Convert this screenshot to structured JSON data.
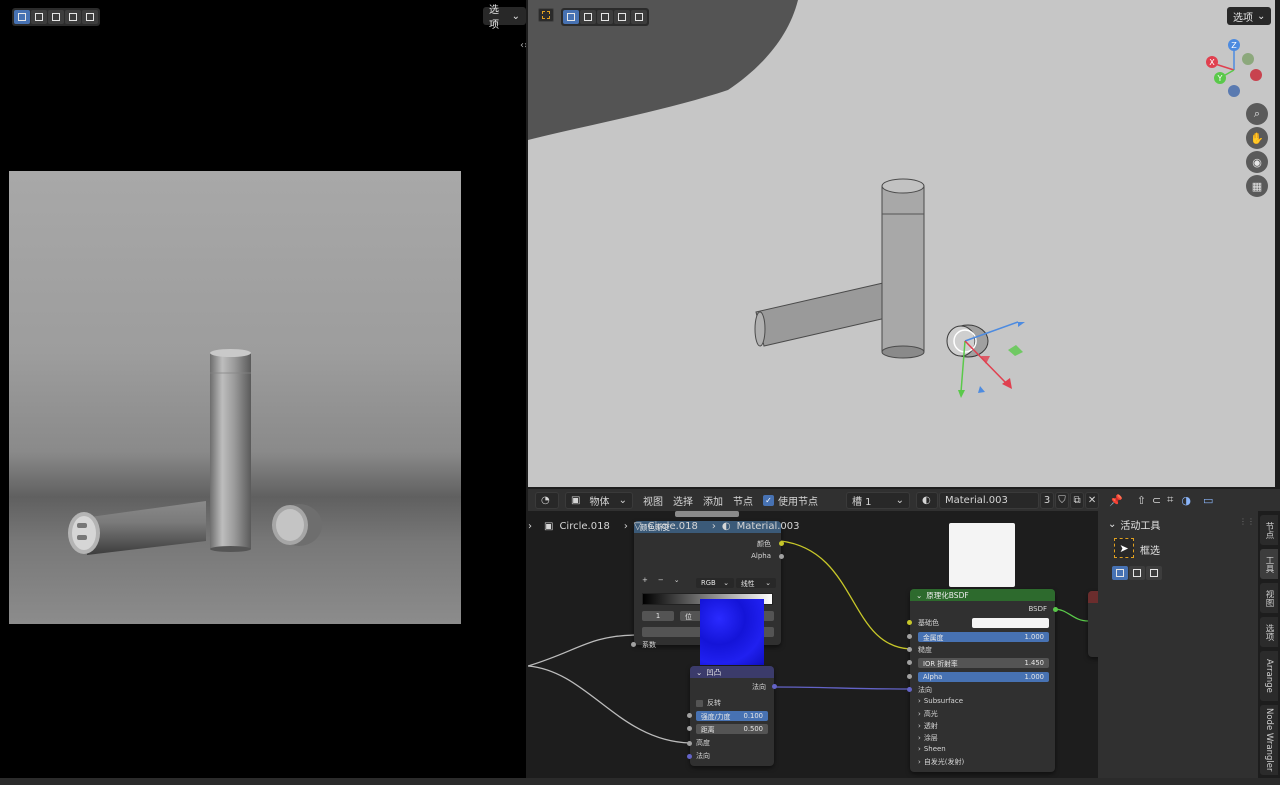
{
  "left_panel": {
    "options_label": "选项"
  },
  "viewport": {
    "options_label": "选项",
    "gizmo_axes": {
      "x": "X",
      "y": "Y",
      "z": "Z"
    }
  },
  "node_header": {
    "object_dropdown": "物体",
    "menu_view": "视图",
    "menu_select": "选择",
    "menu_add": "添加",
    "menu_node": "节点",
    "use_nodes_label": "使用节点",
    "slot_dropdown": "槽 1",
    "material_name": "Material.003",
    "user_count": "3"
  },
  "breadcrumb": {
    "object": "Circle.018",
    "mesh": "Circle.018",
    "material": "Material.003"
  },
  "nodes": {
    "color_ramp": {
      "title": "颜色渐变",
      "out_color": "颜色",
      "out_alpha": "Alpha",
      "mode": "RGB",
      "interp": "线性",
      "index": "1",
      "pos_label": "位",
      "in_fac": "系数"
    },
    "bump": {
      "title": "凹凸",
      "out_normal": "法向",
      "invert": "反转",
      "strength_label": "强度/力度",
      "strength_value": "0.100",
      "distance_label": "距离",
      "distance_value": "0.500",
      "in_height": "高度",
      "in_normal": "法向"
    },
    "bsdf": {
      "title": "原理化BSDF",
      "out_bsdf": "BSDF",
      "base_color": "基础色",
      "metallic_label": "金属度",
      "metallic_value": "1.000",
      "roughness": "糙度",
      "ior_label": "IOR 折射率",
      "ior_value": "1.450",
      "alpha_label": "Alpha",
      "alpha_value": "1.000",
      "normal": "法向",
      "sections": [
        "Subsurface",
        "高光",
        "透射",
        "涂层",
        "Sheen",
        "自发光(发射)"
      ]
    }
  },
  "npanel": {
    "section_title": "活动工具",
    "tool_name": "框选"
  },
  "side_tabs": [
    "节点",
    "工具",
    "视图",
    "选项",
    "Arrange",
    "Node Wrangler"
  ],
  "colors": {
    "accent_blue": "#4772b3",
    "bsdf_header": "#2d6a2d",
    "bump_header": "#3b3b6b",
    "ramp_header": "#3b5a78",
    "socket_yellow": "#c7c729",
    "socket_grey": "#a1a1a1",
    "socket_purple": "#6363c7"
  }
}
